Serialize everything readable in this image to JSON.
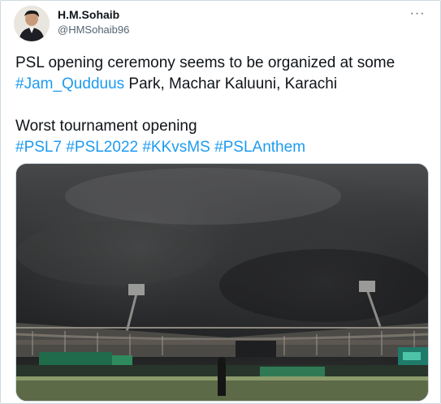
{
  "tweet": {
    "author_name": "H.M.Sohaib",
    "author_handle": "@HMSohaib96",
    "more_label": "···",
    "line1_text": "PSL opening ceremony seems to be organized at some",
    "line2_hashtag": "#Jam_Qudduus",
    "line2_text": " Park, Machar Kaluuni, Karachi",
    "line3_text": "Worst tournament opening",
    "hashtags": [
      "#PSL7",
      "#PSL2022",
      "#KKvsMS",
      "#PSLAnthem"
    ]
  },
  "icons": {
    "avatar": "profile-photo",
    "more": "more-options-icon"
  },
  "colors": {
    "link": "#1d9bf0",
    "text": "#0f1419",
    "secondary": "#536471"
  }
}
